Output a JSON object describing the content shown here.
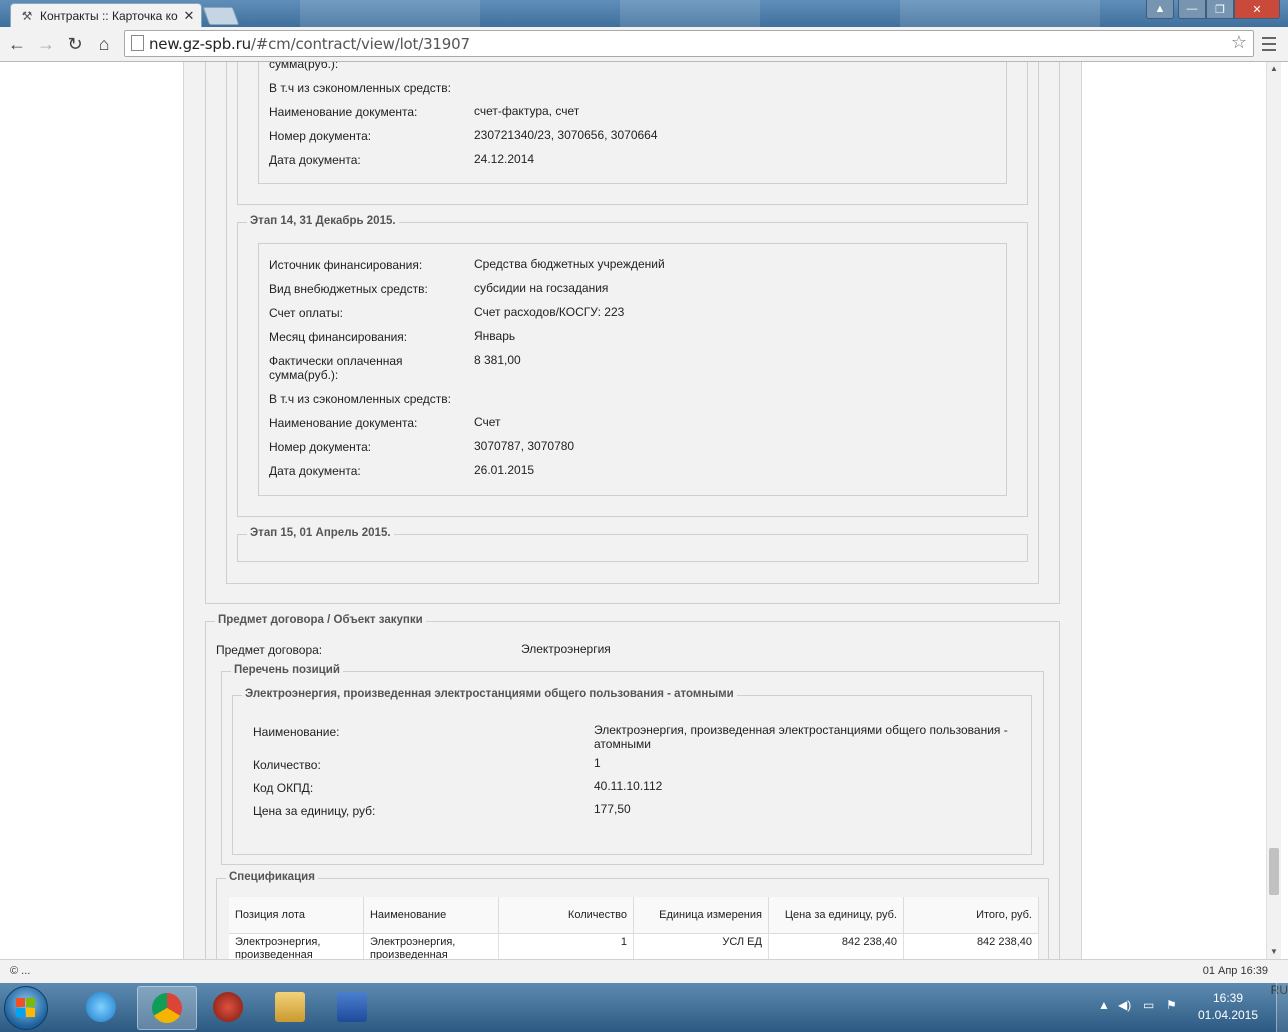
{
  "browser": {
    "tab_title": "Контракты :: Карточка ко",
    "tab_close": "✕",
    "url_host": "new.gz-spb.ru",
    "url_path": "/#cm/contract/view/lot/31907"
  },
  "icons": {
    "back": "back-arrow-icon",
    "forward": "forward-arrow-icon",
    "reload": "reload-icon",
    "home": "home-icon",
    "star": "bookmark-star-icon",
    "menu": "chrome-menu-icon"
  },
  "stage13_tail": {
    "paid_sum_label_tail": "сумма(руб.):",
    "savings_label": "В т.ч из сэкономленных средств:",
    "doc_name_label": "Наименование документа:",
    "doc_name_value": "счет-фактура, счет",
    "doc_number_label": "Номер документа:",
    "doc_number_value": "230721340/23, 3070656, 3070664",
    "doc_date_label": "Дата документа:",
    "doc_date_value": "24.12.2014"
  },
  "stage14": {
    "legend": "Этап 14, 31 Декабрь 2015.",
    "source_label": "Источник финансирования:",
    "source_value": "Средства бюджетных учреждений",
    "type_label": "Вид внебюджетных средств:",
    "type_value": "субсидии на госзадания",
    "account_label": "Счет оплаты:",
    "account_value": "Счет расходов/КОСГУ: 223",
    "month_label": "Месяц финансирования:",
    "month_value": "Январь",
    "paid_label": "Фактически оплаченная сумма(руб.):",
    "paid_value": "8 381,00",
    "savings_label": "В т.ч из сэкономленных средств:",
    "doc_name_label": "Наименование документа:",
    "doc_name_value": "Счет",
    "doc_number_label": "Номер документа:",
    "doc_number_value": "3070787, 3070780",
    "doc_date_label": "Дата документа:",
    "doc_date_value": "26.01.2015"
  },
  "stage15": {
    "legend": "Этап 15, 01 Апрель 2015."
  },
  "subject": {
    "legend": "Предмет договора / Объект закупки",
    "subject_label": "Предмет договора:",
    "subject_value": "Электроэнергия",
    "positions_legend": "Перечень позиций",
    "item_legend": "Электроэнергия, произведенная электростанциями общего пользования - атомными",
    "name_label": "Наименование:",
    "name_value": "Электроэнергия, произведенная электростанциями общего пользования - атомными",
    "qty_label": "Количество:",
    "qty_value": "1",
    "okpd_label": "Код ОКПД:",
    "okpd_value": "40.11.10.112",
    "price_label": "Цена за единицу, руб:",
    "price_value": "177,50"
  },
  "spec": {
    "legend": "Спецификация",
    "headers": [
      "Позиция лота",
      "Наименование",
      "Количество",
      "Единица измерения",
      "Цена за единицу, руб.",
      "Итого, руб."
    ],
    "rows": [
      [
        "Электроэнергия, произведенная",
        "Электроэнергия, произведенная",
        "1",
        "УСЛ ЕД",
        "842 238,40",
        "842 238,40"
      ]
    ]
  },
  "status": {
    "left": "© ...",
    "right": "01 Апр 16:39"
  },
  "taskbar": {
    "lang": "RU",
    "time": "16:39",
    "date": "01.04.2015"
  }
}
